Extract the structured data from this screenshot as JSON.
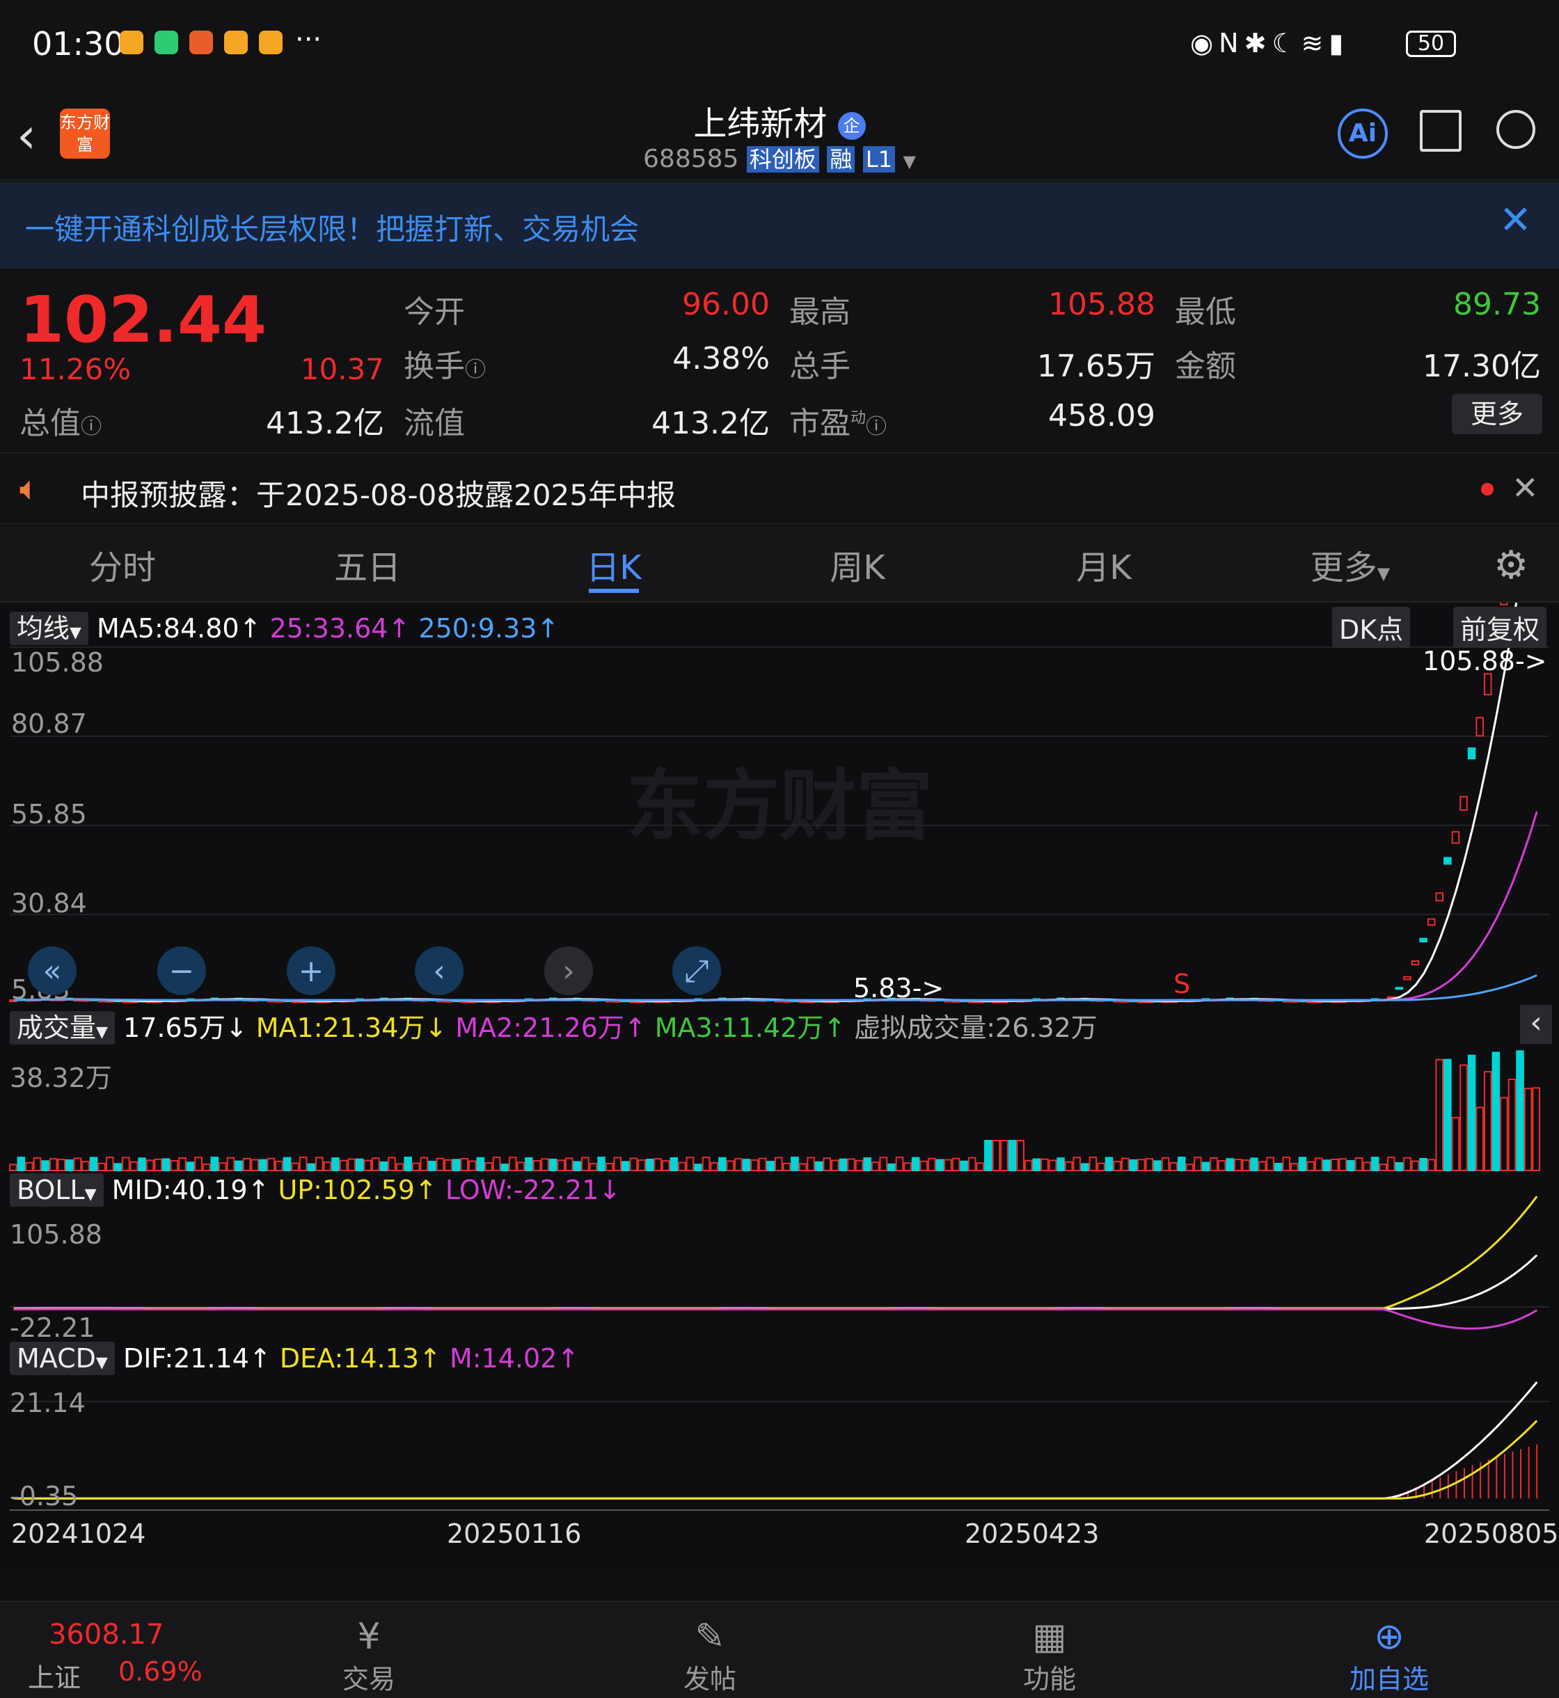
{
  "status": {
    "time": "01:30",
    "battery": "50",
    "more": "···"
  },
  "header": {
    "title": "上纬新材",
    "badge": "企",
    "code": "688585",
    "board_tag": "科创板",
    "margin_tag": "融",
    "level_tag": "L1",
    "logo_text": "东方财富"
  },
  "banner": {
    "text": "一键开通科创成长层权限！把握打新、交易机会"
  },
  "quote": {
    "price": "102.44",
    "change_pct": "11.26%",
    "change": "10.37",
    "total_mv_label": "总值",
    "total_mv": "413.2亿",
    "open_label": "今开",
    "open": "96.00",
    "high_label": "最高",
    "high": "105.88",
    "low_label": "最低",
    "low": "89.73",
    "turnover_label": "换手",
    "turnover": "4.38%",
    "volume_label": "总手",
    "volume": "17.65万",
    "amount_label": "金额",
    "amount": "17.30亿",
    "float_label": "流值",
    "float_mv": "413.2亿",
    "pe_label": "市盈",
    "pe_sup": "动",
    "pe": "458.09",
    "more": "更多"
  },
  "notice": {
    "text": "中报预披露：于2025-08-08披露2025年中报"
  },
  "periods": {
    "tabs": [
      "分时",
      "五日",
      "日K",
      "周K",
      "月K",
      "更多"
    ],
    "active": "日K"
  },
  "kline": {
    "indicator": "均线",
    "ma5": "MA5:84.80↑",
    "ma25": "25:33.64↑",
    "ma250": "250:9.33↑",
    "dk": "DK点",
    "adjust": "前复权",
    "y_labels": [
      "105.88",
      "80.87",
      "55.85",
      "30.84",
      "5.83"
    ],
    "high_marker": "105.88->",
    "low_marker": "5.83->",
    "signal_s": "S",
    "watermark": "东方财富"
  },
  "volume": {
    "indicator": "成交量",
    "value": "17.65万↓",
    "ma1": "MA1:21.34万↓",
    "ma2": "MA2:21.26万↑",
    "ma3": "MA3:11.42万↑",
    "virtual": "虚拟成交量:26.32万",
    "max": "38.32万"
  },
  "boll": {
    "indicator": "BOLL",
    "mid": "MID:40.19↑",
    "up": "UP:102.59↑",
    "low": "LOW:-22.21↓",
    "max": "105.88",
    "min": "-22.21"
  },
  "macd": {
    "indicator": "MACD",
    "dif": "DIF:21.14↑",
    "dea": "DEA:14.13↑",
    "m": "M:14.02↑",
    "max": "21.14",
    "min": "-0.35"
  },
  "dates": [
    "20241024",
    "20250116",
    "20250423",
    "20250805"
  ],
  "bottom": {
    "index_value": "3608.17",
    "index_name": "上证",
    "index_pct": "0.69%",
    "items": [
      "交易",
      "发帖",
      "功能",
      "加自选"
    ]
  },
  "colors": {
    "up": "#f02a2a",
    "down": "#00d4d4",
    "ma5": "#ffffff",
    "ma25": "#d63cd6",
    "ma250": "#4fa3ff",
    "accent": "#4d8dff"
  }
}
